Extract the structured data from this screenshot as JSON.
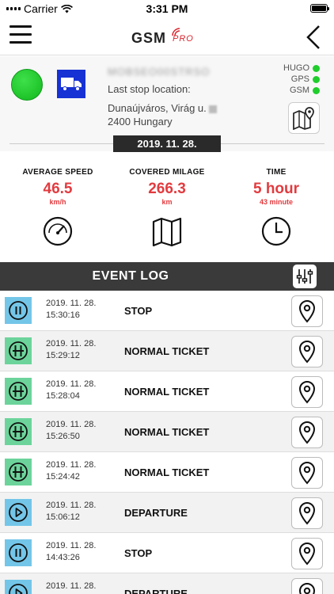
{
  "status_bar": {
    "carrier": "Carrier",
    "time": "3:31 PM"
  },
  "navbar": {
    "logo_main": "GSM",
    "logo_sub": "PRO"
  },
  "vehicle": {
    "name_redacted": "MOBSEO00STRSO",
    "last_stop_label": "Last stop location:",
    "address_line1": "Dunaújváros, Virág u. ",
    "address_line2": "2400 Hungary",
    "indicators": [
      {
        "label": "HUGO",
        "color": "#1fce2c"
      },
      {
        "label": "GPS",
        "color": "#1fce2c"
      },
      {
        "label": "GSM",
        "color": "#1fce2c"
      }
    ],
    "status_color": "#1fc12b",
    "badge_color": "#1631d4"
  },
  "date": "2019. 11. 28.",
  "stats": {
    "speed": {
      "label": "AVERAGE SPEED",
      "value": "46.5",
      "unit": "km/h"
    },
    "milage": {
      "label": "COVERED MILAGE",
      "value": "266.3",
      "unit": "km"
    },
    "time": {
      "label": "TIME",
      "value": "5 hour",
      "unit": "43 minute"
    }
  },
  "event_log": {
    "title": "EVENT LOG",
    "events": [
      {
        "date": "2019. 11. 28.",
        "time": "15:30:16",
        "name": "STOP",
        "icon": "pause-icon"
      },
      {
        "date": "2019. 11. 28.",
        "time": "15:29:12",
        "name": "NORMAL TICKET",
        "icon": "ticket-icon"
      },
      {
        "date": "2019. 11. 28.",
        "time": "15:28:04",
        "name": "NORMAL TICKET",
        "icon": "ticket-icon"
      },
      {
        "date": "2019. 11. 28.",
        "time": "15:26:50",
        "name": "NORMAL TICKET",
        "icon": "ticket-icon"
      },
      {
        "date": "2019. 11. 28.",
        "time": "15:24:42",
        "name": "NORMAL TICKET",
        "icon": "ticket-icon"
      },
      {
        "date": "2019. 11. 28.",
        "time": "15:06:12",
        "name": "DEPARTURE",
        "icon": "play-icon"
      },
      {
        "date": "2019. 11. 28.",
        "time": "14:43:26",
        "name": "STOP",
        "icon": "pause-icon"
      },
      {
        "date": "2019. 11. 28.",
        "time": "",
        "name": "DEPARTURE",
        "icon": "play-icon"
      }
    ]
  }
}
